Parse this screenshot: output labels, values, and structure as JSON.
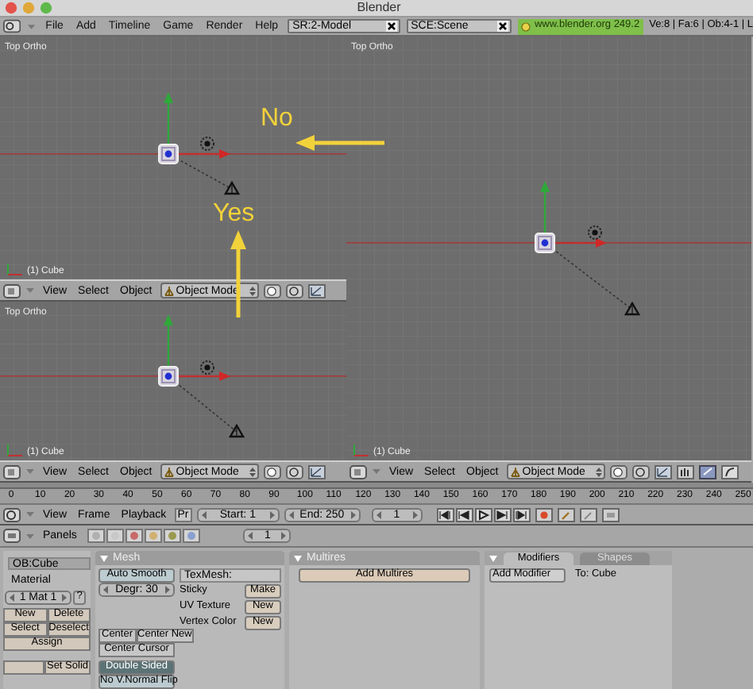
{
  "window": {
    "title": "Blender"
  },
  "menu_bar": {
    "menus": [
      "File",
      "Add",
      "Timeline",
      "Game",
      "Render",
      "Help"
    ],
    "screen_field": "SR:2-Model",
    "scene_field": "SCE:Scene",
    "version": "www.blender.org 249.2",
    "stats": "Ve:8 | Fa:6 | Ob:4-1 | L"
  },
  "viewports": [
    {
      "label": "Top Ortho",
      "object": "(1) Cube",
      "header": {
        "menus": [
          "View",
          "Select",
          "Object"
        ],
        "mode": "Object Mode"
      }
    },
    {
      "label": "Top Ortho",
      "object": "(1) Cube",
      "header": {
        "menus": [
          "View",
          "Select",
          "Object"
        ],
        "mode": "Object Mode"
      }
    },
    {
      "label": "Top Ortho",
      "object": "(1) Cube",
      "header": {
        "menus": [
          "View",
          "Select",
          "Object"
        ],
        "mode": "Object Mode"
      }
    }
  ],
  "annotations": [
    {
      "kind": "arrow_left",
      "text": "No"
    },
    {
      "kind": "arrow_up",
      "text": "Yes"
    }
  ],
  "timeline": {
    "ticks": [
      "0",
      "10",
      "20",
      "30",
      "40",
      "50",
      "60",
      "70",
      "80",
      "90",
      "100",
      "110",
      "120",
      "130",
      "140",
      "150",
      "160",
      "170",
      "180",
      "190",
      "200",
      "210",
      "220",
      "230",
      "240",
      "250"
    ],
    "menus": [
      "View",
      "Frame",
      "Playback"
    ],
    "preview": "Pr",
    "start": "Start: 1",
    "end": "End: 250",
    "current": "1"
  },
  "buttons_window": {
    "header": {
      "label": "Panels",
      "frame": "1"
    },
    "link_panel": {
      "object": "OB:Cube",
      "material_label": "Material",
      "material": "1 Mat 1",
      "help": "?",
      "buttons": [
        "New",
        "Delete",
        "Select",
        "Deselect"
      ],
      "assign": "Assign",
      "set_solid": "Set Solid"
    },
    "mesh_panel": {
      "title": "Mesh",
      "auto_smooth": {
        "label": "Auto Smooth",
        "on": false
      },
      "degr": "Degr: 30",
      "texmesh": "TexMesh:",
      "rows": [
        {
          "label": "Sticky",
          "button": "Make"
        },
        {
          "label": "UV Texture",
          "button": "New"
        },
        {
          "label": "Vertex Color",
          "button": "New"
        }
      ],
      "center": [
        "Center",
        "Center New"
      ],
      "center_cursor": "Center Cursor",
      "double_sided": {
        "label": "Double Sided",
        "on": true
      },
      "normal_flip": {
        "label": "No V.Normal Flip",
        "on": false
      }
    },
    "multires_panel": {
      "title": "Multires",
      "button": "Add Multires"
    },
    "modifiers_panel": {
      "tabs": [
        {
          "label": "Modifiers",
          "selected": true
        },
        {
          "label": "Shapes",
          "selected": false
        }
      ],
      "button": "Add Modifier",
      "target": "To: Cube"
    }
  }
}
